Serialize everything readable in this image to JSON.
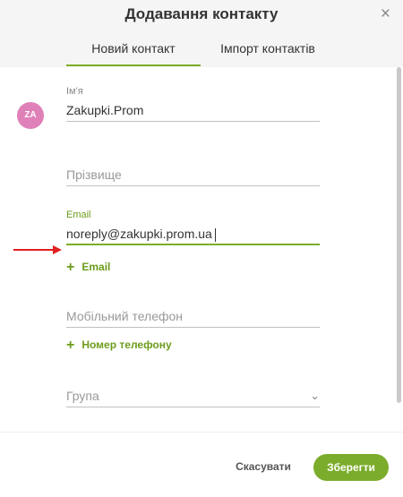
{
  "dialog": {
    "title": "Додавання контакту",
    "close_glyph": "×"
  },
  "tabs": [
    {
      "label": "Новий контакт",
      "active": true
    },
    {
      "label": "Імпорт контактів",
      "active": false
    }
  ],
  "avatar": {
    "initials": "ZA",
    "color": "#e080b8"
  },
  "form": {
    "name": {
      "label": "Ім'я",
      "value": "Zakupki.Prom"
    },
    "surname": {
      "placeholder": "Прізвище"
    },
    "email": {
      "label": "Email",
      "value": "noreply@zakupki.prom.ua"
    },
    "add_email": {
      "plus": "+",
      "label": "Email"
    },
    "phone": {
      "placeholder": "Мобільний телефон"
    },
    "add_phone": {
      "plus": "+",
      "label": "Номер телефону"
    },
    "group": {
      "placeholder": "Група",
      "chevron": "⌄"
    }
  },
  "footer": {
    "cancel_label": "Скасувати",
    "save_label": "Зберегти"
  },
  "colors": {
    "accent": "#7cac2b",
    "annotation_arrow": "#e02020"
  }
}
